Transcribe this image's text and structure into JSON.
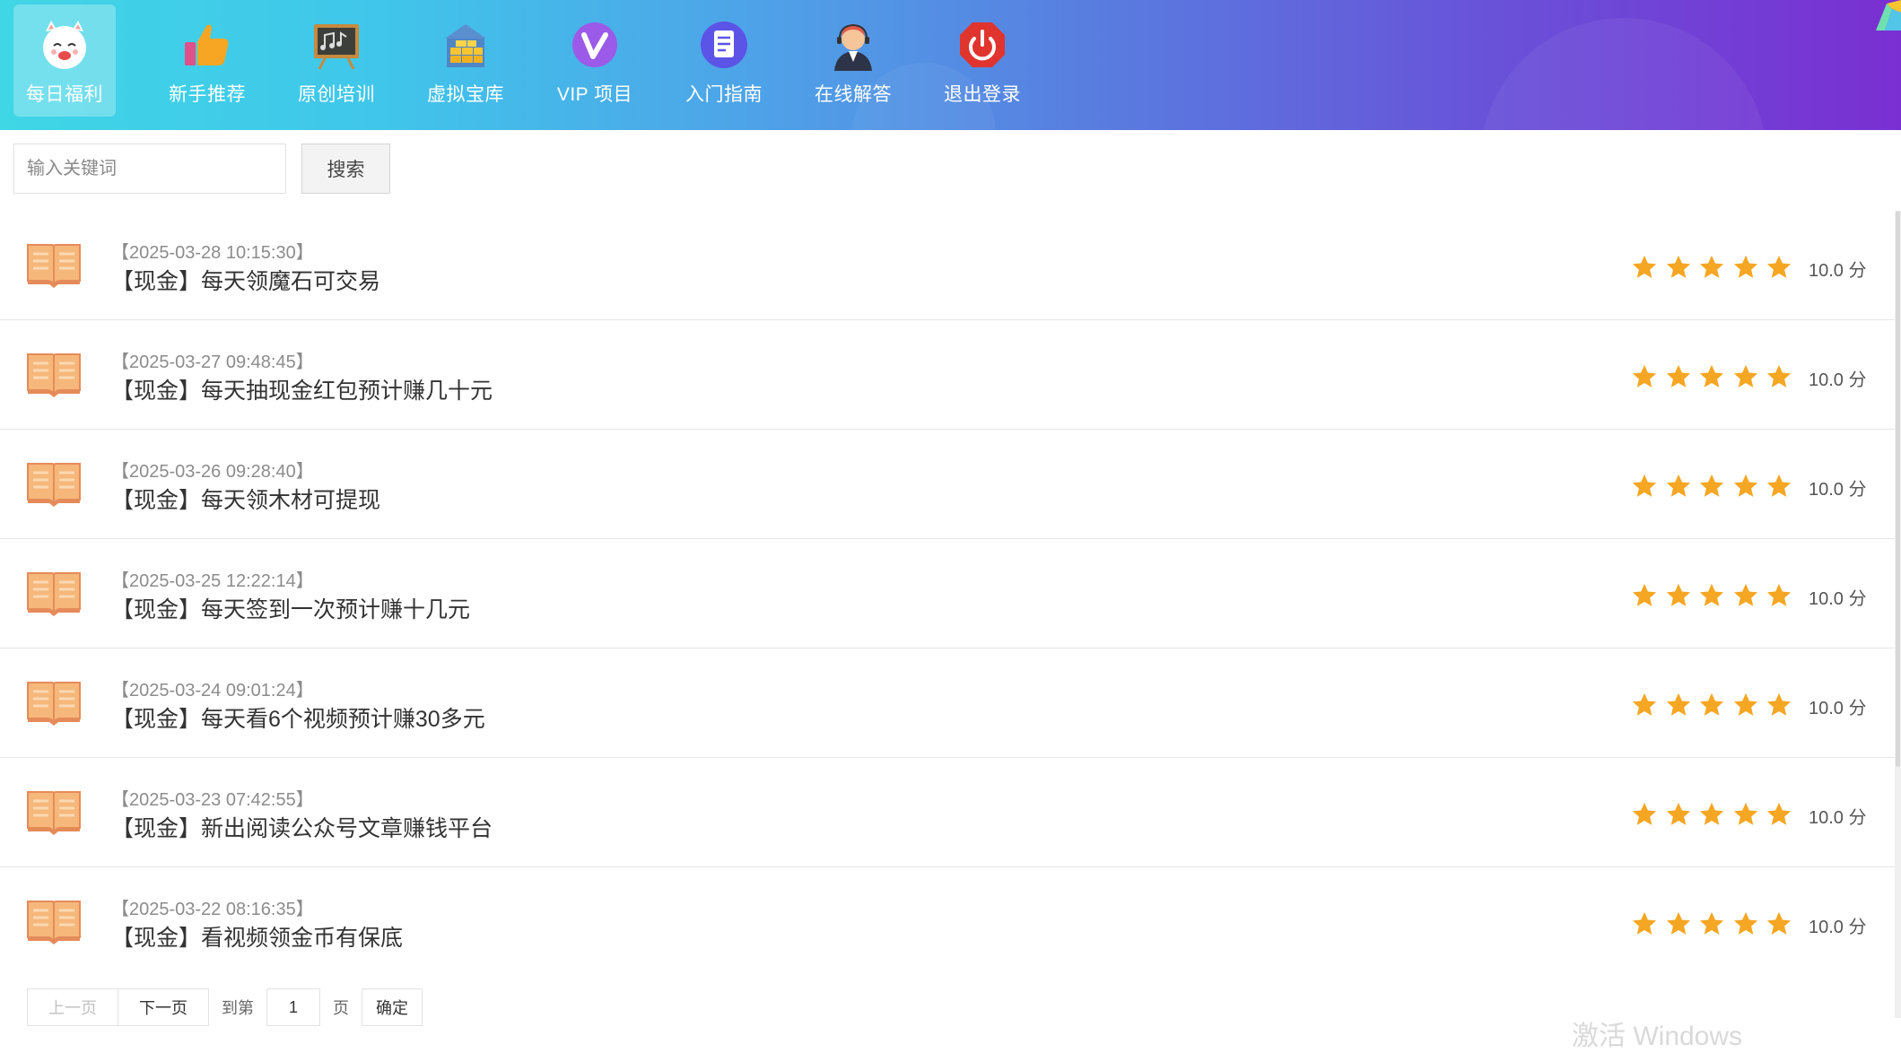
{
  "nav": {
    "items": [
      {
        "label": "每日福利",
        "icon": "lucky-cat-icon",
        "active": true
      },
      {
        "label": "新手推荐",
        "icon": "thumbs-up-icon",
        "active": false
      },
      {
        "label": "原创培训",
        "icon": "blackboard-icon",
        "active": false
      },
      {
        "label": "虚拟宝库",
        "icon": "gold-treasury-icon",
        "active": false
      },
      {
        "label": "VIP 项目",
        "icon": "vip-badge-icon",
        "active": false
      },
      {
        "label": "入门指南",
        "icon": "document-icon",
        "active": false
      },
      {
        "label": "在线解答",
        "icon": "support-agent-icon",
        "active": false
      },
      {
        "label": "退出登录",
        "icon": "power-off-icon",
        "active": false
      }
    ]
  },
  "search": {
    "placeholder": "输入关键词",
    "value": "",
    "button_label": "搜索"
  },
  "list": {
    "items": [
      {
        "date": "【2025-03-28 10:15:30】",
        "title": "【现金】每天领魔石可交易",
        "rating": 5,
        "score": "10.0 分"
      },
      {
        "date": "【2025-03-27 09:48:45】",
        "title": "【现金】每天抽现金红包预计赚几十元",
        "rating": 5,
        "score": "10.0 分"
      },
      {
        "date": "【2025-03-26 09:28:40】",
        "title": "【现金】每天领木材可提现",
        "rating": 5,
        "score": "10.0 分"
      },
      {
        "date": "【2025-03-25 12:22:14】",
        "title": "【现金】每天签到一次预计赚十几元",
        "rating": 5,
        "score": "10.0 分"
      },
      {
        "date": "【2025-03-24 09:01:24】",
        "title": "【现金】每天看6个视频预计赚30多元",
        "rating": 5,
        "score": "10.0 分"
      },
      {
        "date": "【2025-03-23 07:42:55】",
        "title": "【现金】新出阅读公众号文章赚钱平台",
        "rating": 5,
        "score": "10.0 分"
      },
      {
        "date": "【2025-03-22 08:16:35】",
        "title": "【现金】看视频领金币有保底",
        "rating": 5,
        "score": "10.0 分"
      }
    ]
  },
  "pager": {
    "prev_label": "上一页",
    "next_label": "下一页",
    "goto_label": "到第",
    "page_value": "1",
    "page_suffix": "页",
    "confirm_label": "确定"
  },
  "colors": {
    "header_gradient_start": "#3fd6e6",
    "header_gradient_end": "#7a2fd2",
    "star": "#f5a623",
    "book": "#f6b77a"
  },
  "watermark": "激活 Windows"
}
